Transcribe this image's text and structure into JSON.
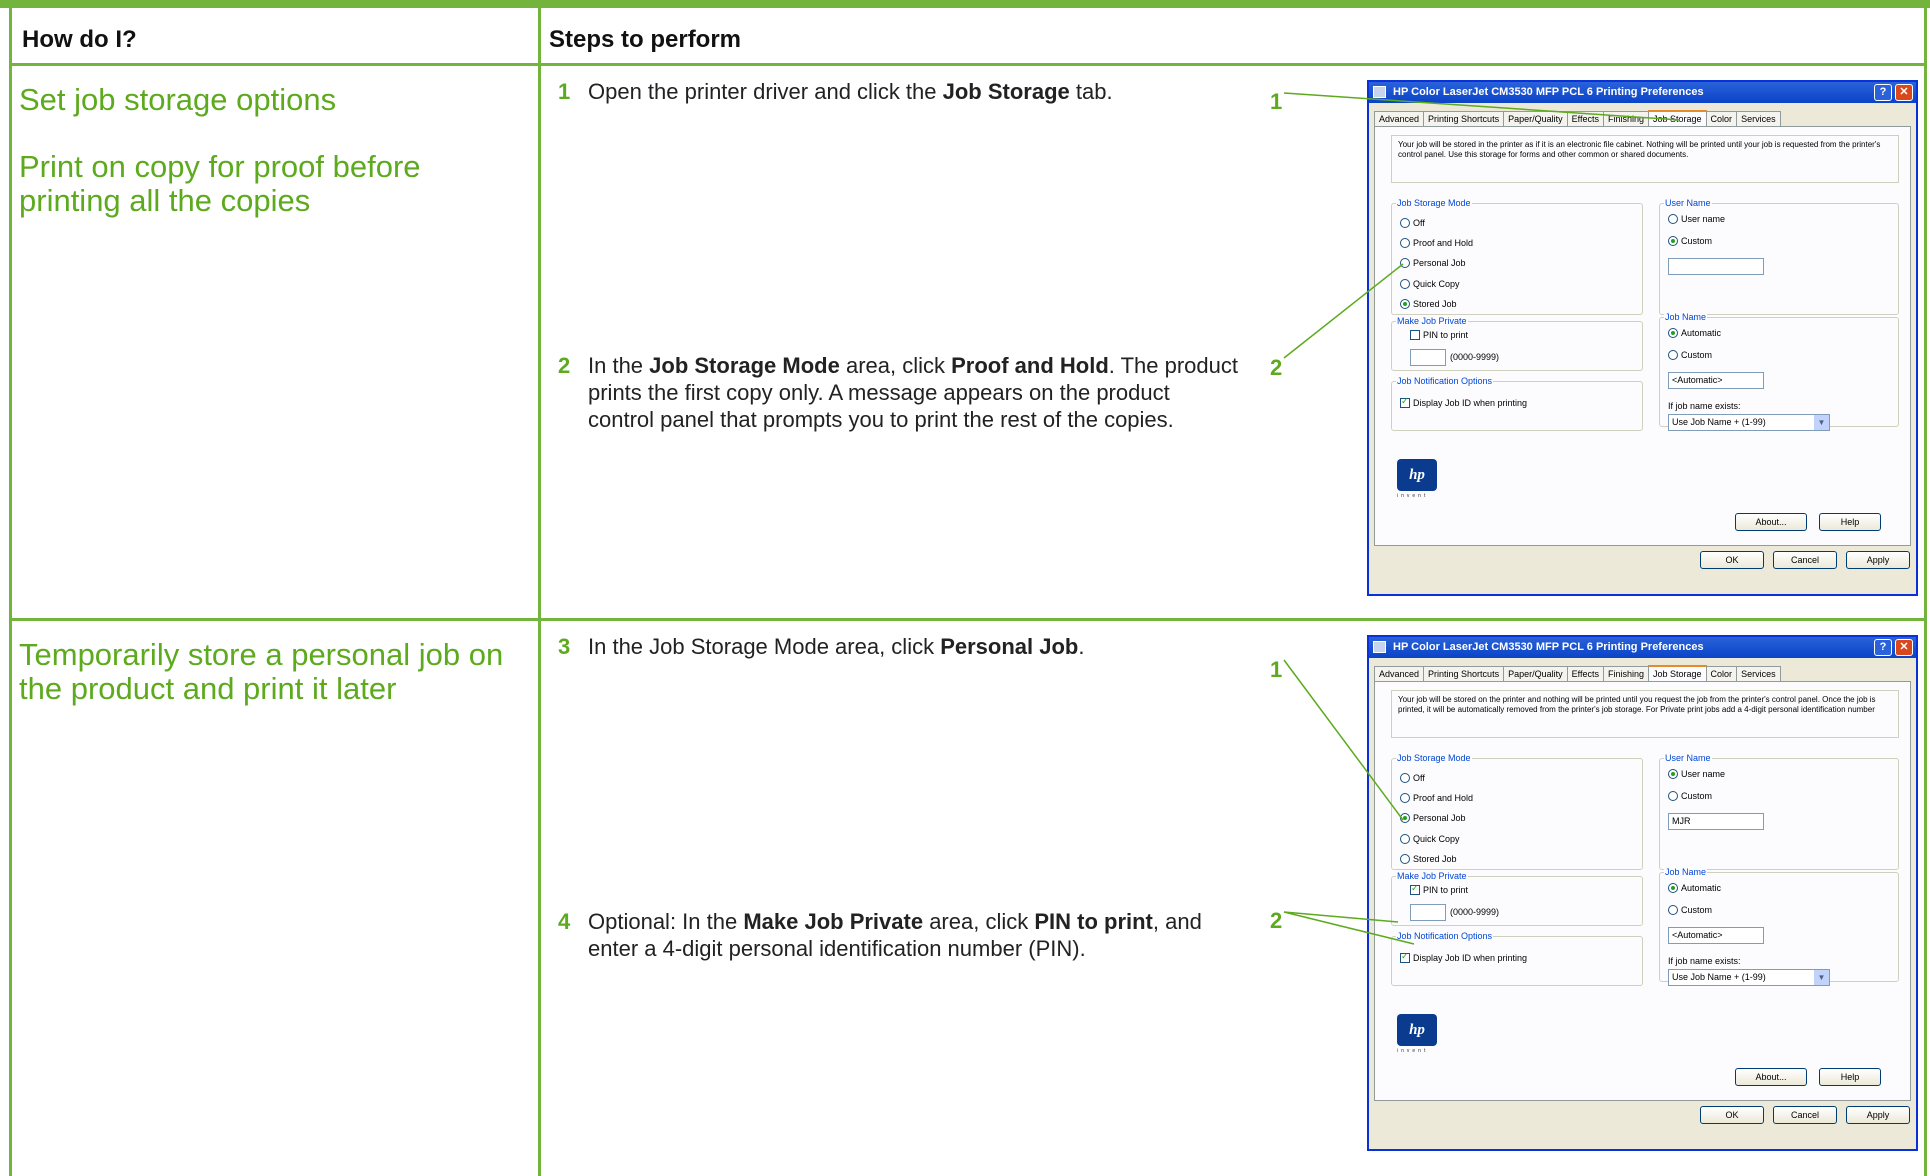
{
  "headers": {
    "how": "How do I?",
    "steps": "Steps to perform"
  },
  "sections": [
    {
      "questions": [
        "Set job storage options",
        "Print on copy for proof before printing all the copies"
      ],
      "steps": [
        {
          "num": "1",
          "parts": [
            "Open the printer driver and click the ",
            "Job Storage",
            " tab."
          ]
        },
        {
          "num": "2",
          "parts": [
            "In the ",
            "Job Storage Mode",
            " area, click ",
            "Proof and Hold",
            ". The product prints the first copy only. A message appears on the product control panel that prompts you to print the rest of the copies."
          ]
        }
      ],
      "callouts": [
        "1",
        "2"
      ]
    },
    {
      "questions": [
        "Temporarily store a personal job on the product and print it later"
      ],
      "steps": [
        {
          "num": "3",
          "parts": [
            "In the Job Storage Mode area, click ",
            "Personal Job",
            "."
          ]
        },
        {
          "num": "4",
          "parts": [
            "Optional: In the ",
            "Make Job Private",
            " area, click ",
            "PIN to print",
            ", and enter a 4-digit personal identification number (PIN)."
          ]
        }
      ],
      "callouts": [
        "1",
        "2"
      ]
    }
  ],
  "dialogs": [
    {
      "title": "HP Color LaserJet CM3530 MFP PCL 6 Printing Preferences",
      "help_btn": "?",
      "close_btn": "✕",
      "tabs": [
        "Advanced",
        "Printing Shortcuts",
        "Paper/Quality",
        "Effects",
        "Finishing",
        "Job Storage",
        "Color",
        "Services"
      ],
      "active_tab": 5,
      "description": "Your job will be stored in the printer as if it is an electronic file cabinet. Nothing will be printed until your job is requested from the printer's control panel. Use this storage for forms and other common or shared documents.",
      "mode_label": "Job Storage Mode",
      "modes": [
        "Off",
        "Proof and Hold",
        "Personal Job",
        "Quick Copy",
        "Stored Job"
      ],
      "mode_selected": 4,
      "private_label": "Make Job Private",
      "pin_label": "PIN to print",
      "pin_checked": false,
      "pin_value": "",
      "pin_range": "(0000-9999)",
      "notify_label": "Job Notification Options",
      "notify_text": "Display Job ID when printing",
      "notify_checked": true,
      "username_label": "User Name",
      "username_options": [
        "User name",
        "Custom"
      ],
      "username_selected": 1,
      "username_value": "",
      "jobname_label": "Job Name",
      "jobname_options": [
        "Automatic",
        "Custom"
      ],
      "jobname_selected": 0,
      "jobname_value": "<Automatic>",
      "exists_label": "If job name exists:",
      "exists_value": "Use Job Name + (1-99)",
      "logo_text": "hp",
      "logo_sub": "invent",
      "btn_about": "About...",
      "btn_help": "Help",
      "btn_ok": "OK",
      "btn_cancel": "Cancel",
      "btn_apply": "Apply"
    },
    {
      "title": "HP Color LaserJet CM3530 MFP PCL 6 Printing Preferences",
      "help_btn": "?",
      "close_btn": "✕",
      "tabs": [
        "Advanced",
        "Printing Shortcuts",
        "Paper/Quality",
        "Effects",
        "Finishing",
        "Job Storage",
        "Color",
        "Services"
      ],
      "active_tab": 5,
      "description": "Your job will be stored on the printer and nothing will be printed until you request the job from the printer's control panel. Once the job is printed, it will be automatically removed from the printer's job storage. For Private print jobs add a 4-digit personal identification number",
      "mode_label": "Job Storage Mode",
      "modes": [
        "Off",
        "Proof and Hold",
        "Personal Job",
        "Quick Copy",
        "Stored Job"
      ],
      "mode_selected": 2,
      "private_label": "Make Job Private",
      "pin_label": "PIN to print",
      "pin_checked": true,
      "pin_value": "",
      "pin_range": "(0000-9999)",
      "notify_label": "Job Notification Options",
      "notify_text": "Display Job ID when printing",
      "notify_checked": true,
      "username_label": "User Name",
      "username_options": [
        "User name",
        "Custom"
      ],
      "username_selected": 0,
      "username_value": "MJR",
      "jobname_label": "Job Name",
      "jobname_options": [
        "Automatic",
        "Custom"
      ],
      "jobname_selected": 0,
      "jobname_value": "<Automatic>",
      "exists_label": "If job name exists:",
      "exists_value": "Use Job Name + (1-99)",
      "logo_text": "hp",
      "logo_sub": "invent",
      "btn_about": "About...",
      "btn_help": "Help",
      "btn_ok": "OK",
      "btn_cancel": "Cancel",
      "btn_apply": "Apply"
    }
  ],
  "colors": {
    "accent": "#73b43c",
    "question": "#5daa1e",
    "dialog_frame": "#0831d9"
  }
}
